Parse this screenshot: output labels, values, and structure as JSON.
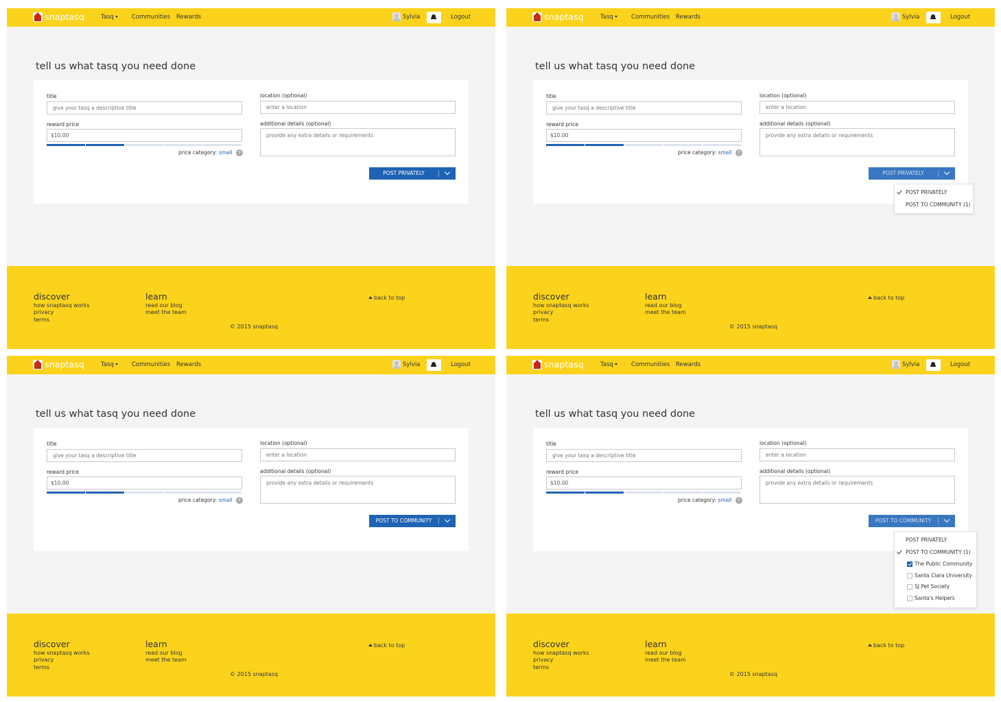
{
  "navbar": {
    "brand": "snaptasq",
    "menu_tasq": "Tasq",
    "menu_communities": "Communities",
    "menu_rewards": "Rewards",
    "user_name": "Sylvia",
    "logout": "Logout"
  },
  "form": {
    "heading": "tell us what tasq you need done",
    "title_label": "title",
    "title_placeholder": "give your tasq a descriptive title",
    "reward_label": "reward price",
    "reward_value": "$10.00",
    "price_category_label": "price category:",
    "price_category_value": "small",
    "help_glyph": "?",
    "price_meter_level": "2 of 5",
    "location_label": "location (optional)",
    "location_placeholder": "enter a location",
    "details_label": "additional details (optional)",
    "details_placeholder": "provide any extra details or requirements"
  },
  "screens": [
    {
      "button_label": "POST PRIVATELY",
      "dropdown_open": false
    },
    {
      "button_label": "POST PRIVATELY",
      "dropdown_open": true,
      "dropdown": {
        "item_private": "POST PRIVATELY",
        "item_community": "POST TO COMMUNITY (1)",
        "selected": "private"
      }
    },
    {
      "button_label": "POST TO COMMUNITY",
      "dropdown_open": false
    },
    {
      "button_label": "POST TO COMMUNITY",
      "dropdown_open": true,
      "dropdown": {
        "item_private": "POST PRIVATELY",
        "item_community": "POST TO COMMUNITY (1)",
        "selected": "community",
        "communities": [
          {
            "name": "The Public Community",
            "checked": true
          },
          {
            "name": "Santa Clara University",
            "checked": false
          },
          {
            "name": "SJ Pet Society",
            "checked": false
          },
          {
            "name": "Santa's Helpers",
            "checked": false
          }
        ]
      }
    }
  ],
  "footer": {
    "discover_heading": "discover",
    "discover_links": [
      "how snaptasq works",
      "privacy",
      "terms"
    ],
    "learn_heading": "learn",
    "learn_links": [
      "read our blog",
      "meet the team"
    ],
    "back_to_top": "back to top",
    "copyright": "© 2015 snaptasq"
  },
  "colors": {
    "brand_yellow": "#fbd31c",
    "primary_blue": "#1f63b4",
    "page_bg": "#f4f4f4"
  }
}
